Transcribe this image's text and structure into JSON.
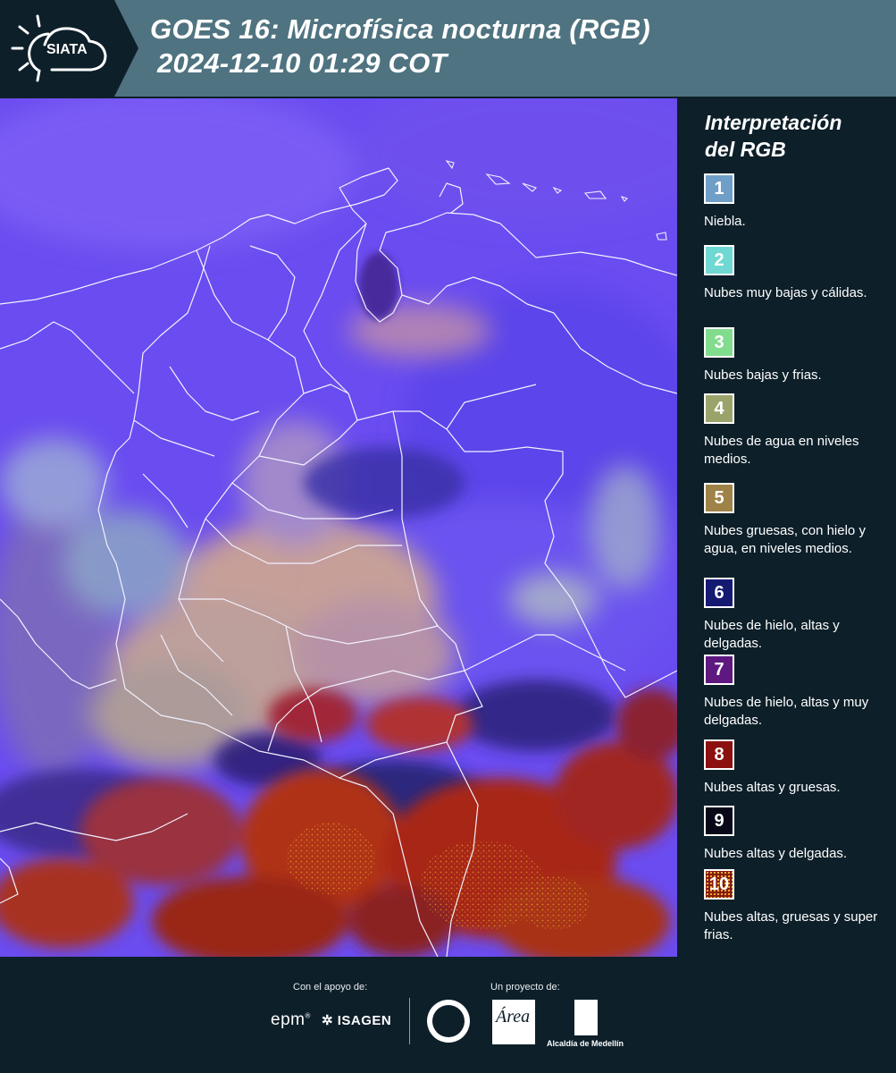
{
  "header": {
    "logo_text": "SIATA",
    "title_line1": "GOES 16: Microfísica nocturna (RGB)",
    "title_line2": "2024-12-10 01:29 COT"
  },
  "legend": {
    "title_line1": "Interpretación",
    "title_line2": "del RGB",
    "items": [
      {
        "number": "1",
        "label": "Niebla.",
        "color": "#6f9ec8"
      },
      {
        "number": "2",
        "label": "Nubes muy bajas y cálidas.",
        "color": "#6fd8d2"
      },
      {
        "number": "3",
        "label": "Nubes bajas y frias.",
        "color": "#82dc8e"
      },
      {
        "number": "4",
        "label": "Nubes de agua en niveles medios.",
        "color": "#9aa46a"
      },
      {
        "number": "5",
        "label": "Nubes gruesas, con hielo y agua, en niveles medios.",
        "color": "#9e8248"
      },
      {
        "number": "6",
        "label": "Nubes de hielo, altas y delgadas.",
        "color": "#141a72"
      },
      {
        "number": "7",
        "label": "Nubes de hielo, altas y muy delgadas.",
        "color": "#5e1880"
      },
      {
        "number": "8",
        "label": "Nubes altas y gruesas.",
        "color": "#8c1010"
      },
      {
        "number": "9",
        "label": "Nubes altas y delgadas.",
        "color": "#080818"
      },
      {
        "number": "10",
        "label": "Nubes altas, gruesas y super frias.",
        "color": "#8a1a10"
      }
    ]
  },
  "footer": {
    "support_label": "Con el apoyo de:",
    "project_label": "Un proyecto de:",
    "epm": "epm",
    "isagen": "ISAGEN",
    "area_logo_text": "Área",
    "alcaldia": "Alcaldía de Medellín"
  },
  "colors": {
    "header_bg": "#4f7380",
    "logo_panel_bg": "#0d1f29",
    "page_bg": "#0d1f29",
    "map_base": "#6a4cf0"
  }
}
